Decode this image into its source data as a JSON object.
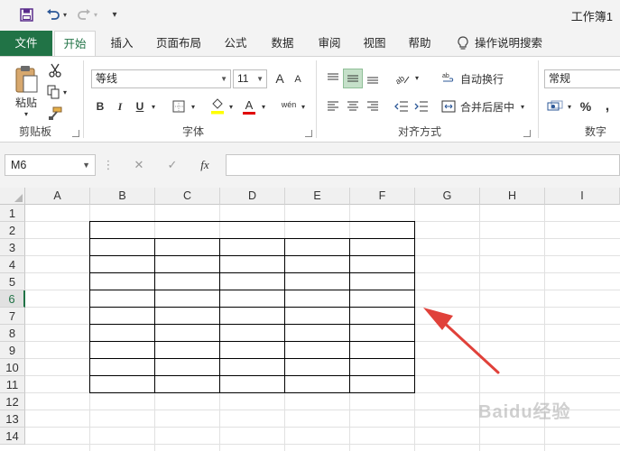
{
  "window": {
    "title": "工作簿1"
  },
  "quick_access": {
    "icons": [
      "save-icon",
      "undo-icon",
      "redo-icon",
      "customize-icon"
    ],
    "customize_glyph": "▾"
  },
  "tabs": [
    {
      "label": "文件",
      "key": "file"
    },
    {
      "label": "开始",
      "key": "home",
      "active": true
    },
    {
      "label": "插入",
      "key": "insert"
    },
    {
      "label": "页面布局",
      "key": "layout"
    },
    {
      "label": "公式",
      "key": "formulas"
    },
    {
      "label": "数据",
      "key": "data"
    },
    {
      "label": "审阅",
      "key": "review"
    },
    {
      "label": "视图",
      "key": "view"
    },
    {
      "label": "帮助",
      "key": "help"
    }
  ],
  "tell_me": {
    "label": "操作说明搜索"
  },
  "ribbon": {
    "clipboard": {
      "label": "剪贴板",
      "paste_label": "粘贴"
    },
    "font": {
      "label": "字体",
      "font_name": "等线",
      "font_size": "11",
      "bold": "B",
      "italic": "I",
      "underline": "U",
      "grow": "A",
      "shrink": "A",
      "font_color_glyph": "A",
      "phonetic": "wén"
    },
    "alignment": {
      "label": "对齐方式",
      "wrap_text": "自动换行",
      "merge_center": "合并后居中"
    },
    "number": {
      "label": "数字",
      "format": "常规",
      "percent": "%"
    }
  },
  "formula_bar": {
    "name_box": "M6",
    "fx": "fx",
    "formula": ""
  },
  "sheet": {
    "columns": [
      "A",
      "B",
      "C",
      "D",
      "E",
      "F",
      "G",
      "H",
      "I"
    ],
    "rows": [
      "1",
      "2",
      "3",
      "4",
      "5",
      "6",
      "7",
      "8",
      "9",
      "10",
      "11",
      "12",
      "13",
      "14"
    ],
    "active_row": "6",
    "active_cell": "M6",
    "bordered_table": {
      "merged_title_row": "2",
      "first_column": "B",
      "last_column": "F",
      "first_row": "2",
      "last_row": "11"
    }
  },
  "annotation": {
    "type": "red-arrow",
    "color": "#e0413a"
  },
  "watermark": {
    "text": "Baidu经验"
  },
  "colors": {
    "accent": "#217346",
    "selection": "#c5e0c9",
    "arrow": "#e0413a"
  }
}
